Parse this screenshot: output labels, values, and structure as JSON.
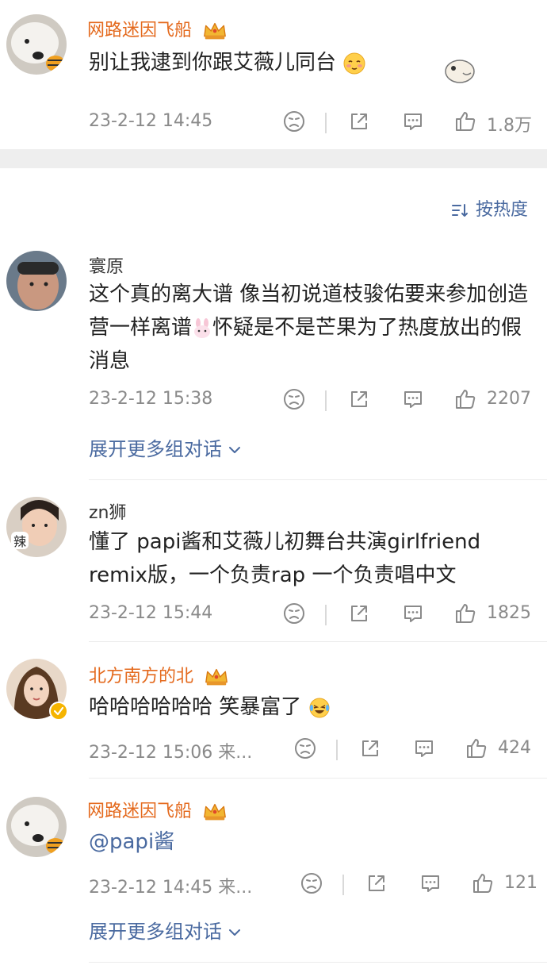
{
  "top_comment": {
    "username": "网路迷因飞船",
    "text": "别让我逮到你跟艾薇儿同台",
    "time": "23-2-12 14:45",
    "likes": "1.8万"
  },
  "sort_label": "按热度",
  "comments": [
    {
      "username": "寰原",
      "text": "这个真的离大谱 像当初说道枝骏佑要来参加创造营一样离谱",
      "text_after_emoji": "怀疑是不是芒果为了热度放出的假消息",
      "time": "23-2-12 15:38",
      "likes": "2207",
      "expand": "展开更多组对话"
    },
    {
      "username": "zn狮",
      "text": "懂了 papi酱和艾薇儿初舞台共演girlfriend remix版，一个负责rap 一个负责唱中文",
      "time": "23-2-12 15:44",
      "likes": "1825"
    },
    {
      "username": "北方南方的北",
      "text": "哈哈哈哈哈哈 笑暴富了",
      "time": "23-2-12 15:06 来...",
      "likes": "424"
    },
    {
      "username": "网路迷因飞船",
      "text": "@papi酱",
      "time": "23-2-12 14:45 来...",
      "likes": "121",
      "expand": "展开更多组对话"
    }
  ],
  "colors": {
    "vip_name": "#e46a1e",
    "link": "#4a6aa0",
    "meta": "#8a8a8a"
  },
  "icons": [
    "face-icon",
    "share-icon",
    "comment-icon",
    "like-icon",
    "chevron-down-icon",
    "sort-icon",
    "crown-icon",
    "verified-icon"
  ]
}
